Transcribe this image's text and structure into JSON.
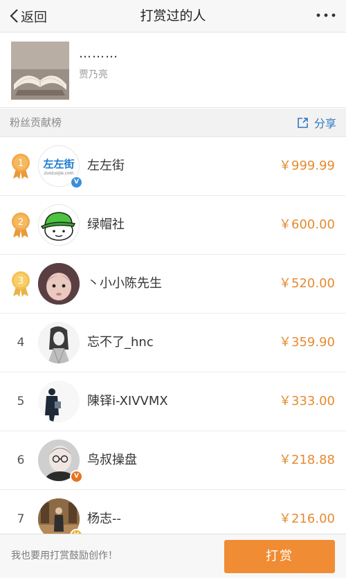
{
  "nav": {
    "back_label": "返回",
    "title": "打赏过的人"
  },
  "post": {
    "title": "………",
    "author": "贾乃亮"
  },
  "section": {
    "title": "粉丝贡献榜",
    "share_label": "分享"
  },
  "rows": [
    {
      "rank": "1",
      "name": "左左街",
      "amount": "￥999.99",
      "avatar_text": "左左街",
      "avatar_subtext": "zuozuojie.com",
      "badge": "blue"
    },
    {
      "rank": "2",
      "name": "绿帽社",
      "amount": "￥600.00"
    },
    {
      "rank": "3",
      "name": "丶小小陈先生",
      "amount": "￥520.00"
    },
    {
      "rank": "4",
      "name": "忘不了_hnc",
      "amount": "￥359.90"
    },
    {
      "rank": "5",
      "name": "陳铎i-XIVVMX",
      "amount": "￥333.00"
    },
    {
      "rank": "6",
      "name": "鸟叔操盘",
      "amount": "￥218.88",
      "badge": "orange"
    },
    {
      "rank": "7",
      "name": "杨志--",
      "amount": "￥216.00",
      "badge": "orange"
    }
  ],
  "badge_text": "V",
  "colors": {
    "accent": "#f08c33",
    "amount": "#e68a2e",
    "link": "#2e78c0",
    "medal": "#f0a840"
  },
  "footer": {
    "hint": "我也要用打赏鼓励创作！",
    "tip_button": "打赏"
  }
}
